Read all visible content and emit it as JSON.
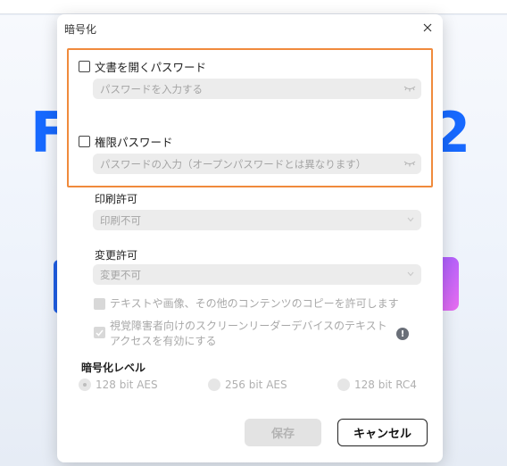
{
  "background": {
    "left_text": "F",
    "right_text": "2"
  },
  "dialog": {
    "title": "暗号化",
    "open_password": {
      "label": "文書を開くパスワード",
      "placeholder": "パスワードを入力する",
      "checked": false
    },
    "permission_password": {
      "label": "権限パスワード",
      "placeholder": "パスワードの入力（オープンパスワードとは異なります）",
      "checked": false
    },
    "print_permission": {
      "label": "印刷許可",
      "value": "印刷不可"
    },
    "change_permission": {
      "label": "変更許可",
      "value": "変更不可"
    },
    "allow_copy": {
      "label": "テキストや画像、その他のコンテンツのコピーを許可します",
      "checked": false
    },
    "screen_reader": {
      "label_line1": "視覚障害者向けのスクリーンリーダーデバイスのテキスト",
      "label_line2": "アクセスを有効にする",
      "checked": true
    },
    "encryption_level": {
      "label": "暗号化レベル",
      "options": [
        "128 bit AES",
        "256 bit AES",
        "128 bit RC4"
      ],
      "selected": "128 bit AES"
    },
    "save_label": "保存",
    "cancel_label": "キャンセル",
    "info_glyph": "!"
  },
  "colors": {
    "highlight_border": "#f08a3c",
    "brand_blue": "#1769ff"
  }
}
